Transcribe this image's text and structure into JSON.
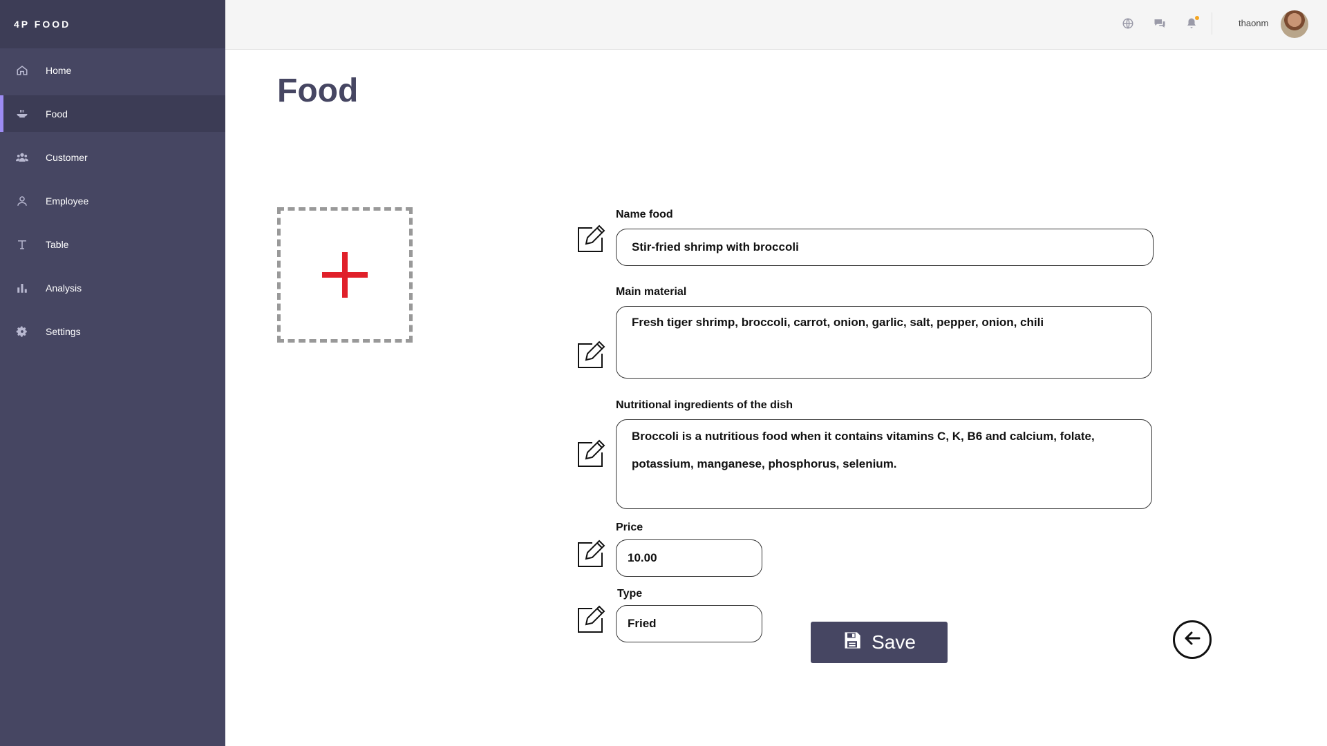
{
  "brand": "4P FOOD",
  "sidebar": {
    "items": [
      {
        "label": "Home",
        "icon": "home-icon"
      },
      {
        "label": "Food",
        "icon": "bowl-icon",
        "active": true
      },
      {
        "label": "Customer",
        "icon": "users-icon"
      },
      {
        "label": "Employee",
        "icon": "user-icon"
      },
      {
        "label": "Table",
        "icon": "text-tool-icon"
      },
      {
        "label": "Analysis",
        "icon": "bar-chart-icon"
      },
      {
        "label": "Settings",
        "icon": "gear-icon"
      }
    ]
  },
  "topbar": {
    "username": "thaonm",
    "icons": [
      "globe-icon",
      "chat-icon",
      "bell-icon"
    ],
    "notification_color": "#f5a623"
  },
  "page": {
    "title": "Food"
  },
  "form": {
    "name_food": {
      "label": "Name food",
      "value": "Stir-fried shrimp with broccoli"
    },
    "main_material": {
      "label": "Main material",
      "value": "Fresh tiger shrimp, broccoli, carrot, onion, garlic, salt, pepper, onion, chili"
    },
    "nutrition": {
      "label": "Nutritional ingredients of the dish",
      "value": "Broccoli is a nutritious food when it contains vitamins C, K, B6 and calcium, folate, potassium, manganese, phosphorus, selenium."
    },
    "price": {
      "label": "Price",
      "value": "10.00"
    },
    "type": {
      "label": "Type",
      "value": "Fried"
    }
  },
  "actions": {
    "save_label": "Save"
  },
  "colors": {
    "sidebar": "#464662",
    "accent": "#9d8cf3",
    "plus": "#e0202a"
  }
}
